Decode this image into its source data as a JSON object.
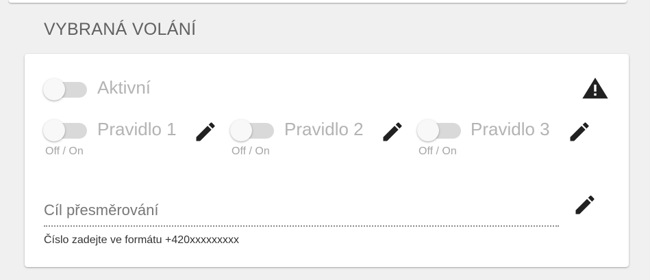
{
  "section": {
    "title": "VYBRANÁ VOLÁNÍ"
  },
  "active_toggle": {
    "label": "Aktivní",
    "checked": false
  },
  "warning": {
    "icon": "warning-icon"
  },
  "rules": [
    {
      "label": "Pravidlo 1",
      "helper": "Off / On",
      "checked": false,
      "edit_icon": "pencil-icon"
    },
    {
      "label": "Pravidlo 2",
      "helper": "Off / On",
      "checked": false,
      "edit_icon": "pencil-icon"
    },
    {
      "label": "Pravidlo 3",
      "helper": "Off / On",
      "checked": false,
      "edit_icon": "pencil-icon"
    }
  ],
  "redirect_field": {
    "label": "Cíl přesměrování",
    "value": "",
    "hint": "Číslo zadejte ve formátu +420xxxxxxxxx",
    "edit_icon": "pencil-icon"
  },
  "colors": {
    "page_background": "#f0f0f0",
    "card_background": "#ffffff",
    "disabled_text": "#b3b3b3",
    "icon": "#212121"
  }
}
